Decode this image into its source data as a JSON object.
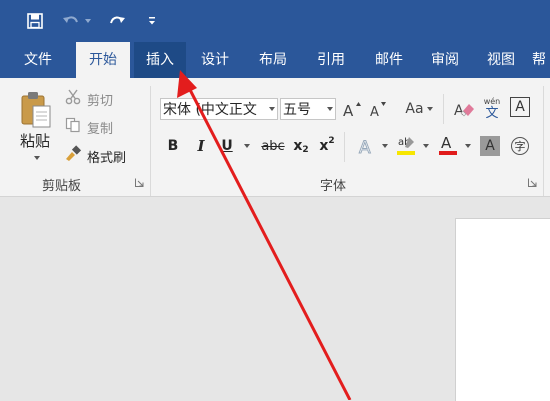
{
  "quick_access": {
    "save_icon": "save-icon",
    "undo_icon": "undo-icon",
    "redo_icon": "redo-icon",
    "customize_icon": "customize-qat-icon"
  },
  "tabs": [
    {
      "label": "文件"
    },
    {
      "label": "开始"
    },
    {
      "label": "插入"
    },
    {
      "label": "设计"
    },
    {
      "label": "布局"
    },
    {
      "label": "引用"
    },
    {
      "label": "邮件"
    },
    {
      "label": "审阅"
    },
    {
      "label": "视图"
    },
    {
      "label": "帮"
    }
  ],
  "clipboard": {
    "paste_label": "粘贴",
    "cut_label": "剪切",
    "copy_label": "复制",
    "format_painter_label": "格式刷",
    "group_label": "剪贴板"
  },
  "font": {
    "font_name": "宋体 (中文正文",
    "font_size": "五号",
    "bold": "B",
    "italic": "I",
    "underline": "U",
    "strikethrough": "abc",
    "subscript_base": "x",
    "subscript_mark": "2",
    "superscript_base": "x",
    "superscript_mark": "2",
    "change_case": "Aa",
    "phonetic_top": "wén",
    "phonetic_char": "文",
    "border_char": "A",
    "enclose_char": "字",
    "group_label": "字体",
    "highlight_color": "#f7e600",
    "font_color": "#e01b1b"
  },
  "colors": {
    "ribbon_blue": "#2b579a",
    "annotation_red": "#e31d1d"
  }
}
